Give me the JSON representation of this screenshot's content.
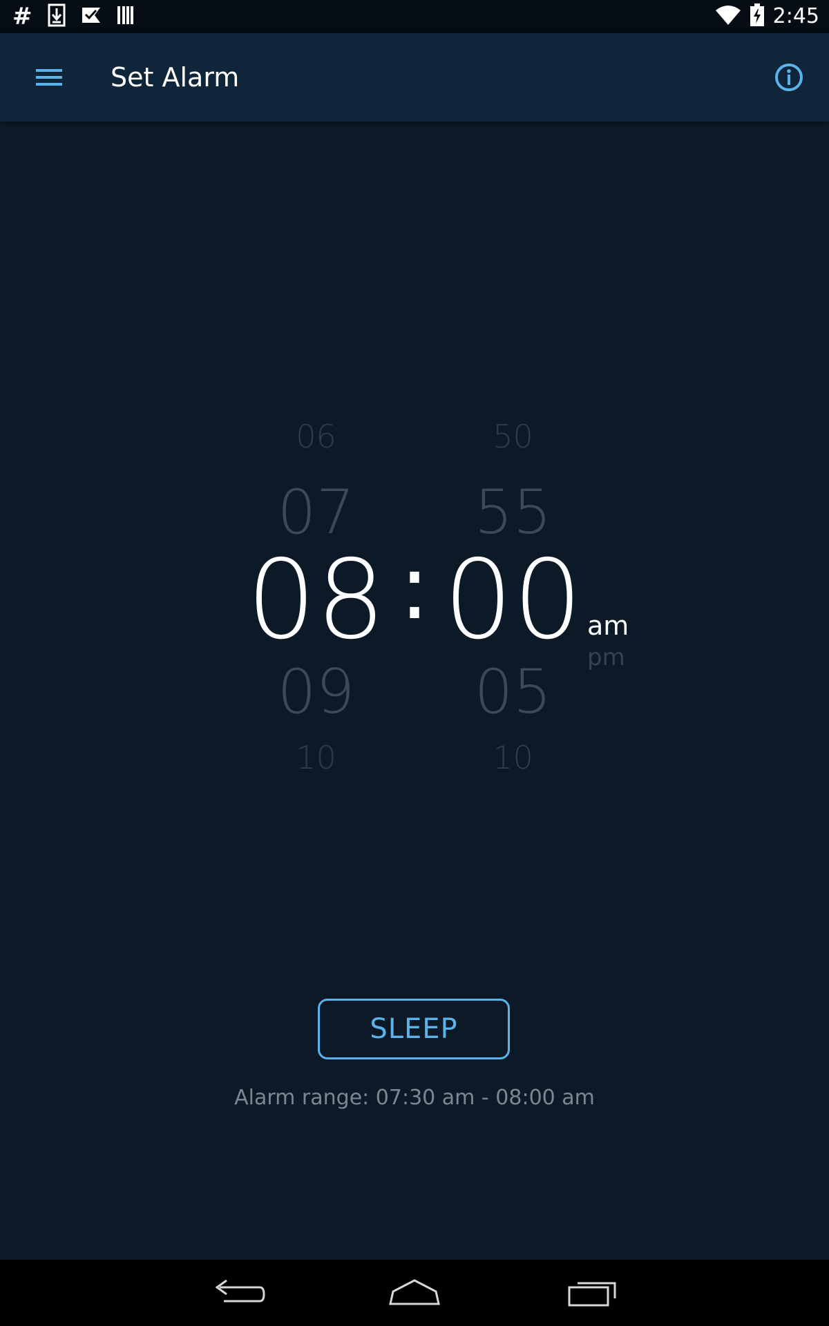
{
  "status_bar": {
    "left_icons": [
      "hash-icon",
      "download-icon",
      "check-flag-icon",
      "barcode-icon"
    ],
    "hash_glyph": "#",
    "right_icons": [
      "wifi-icon",
      "battery-charging-icon"
    ],
    "time": "2:45"
  },
  "app_bar": {
    "title": "Set Alarm",
    "menu_icon": "hamburger-menu-icon",
    "info_icon": "info-icon",
    "accent_color": "#5bb3ea",
    "background_color": "#0f253a"
  },
  "time_picker": {
    "hours": {
      "far_above": "06",
      "above": "07",
      "selected": "08",
      "below": "09",
      "far_below": "10"
    },
    "separator": ":",
    "minutes": {
      "far_above": "50",
      "above": "55",
      "selected": "00",
      "below": "05",
      "far_below": "10"
    },
    "period": {
      "selected": "am",
      "other": "pm"
    }
  },
  "sleep_button": {
    "label": "SLEEP"
  },
  "alarm_range": {
    "text": "Alarm range: 07:30 am - 08:00 am"
  },
  "nav_bar": {
    "icons": [
      "back-icon",
      "home-icon",
      "recents-icon"
    ]
  },
  "colors": {
    "background": "#0c1a28",
    "selected_text": "#ffffff",
    "dim_text": "#3a4755",
    "secondary_text": "#7c8793"
  }
}
